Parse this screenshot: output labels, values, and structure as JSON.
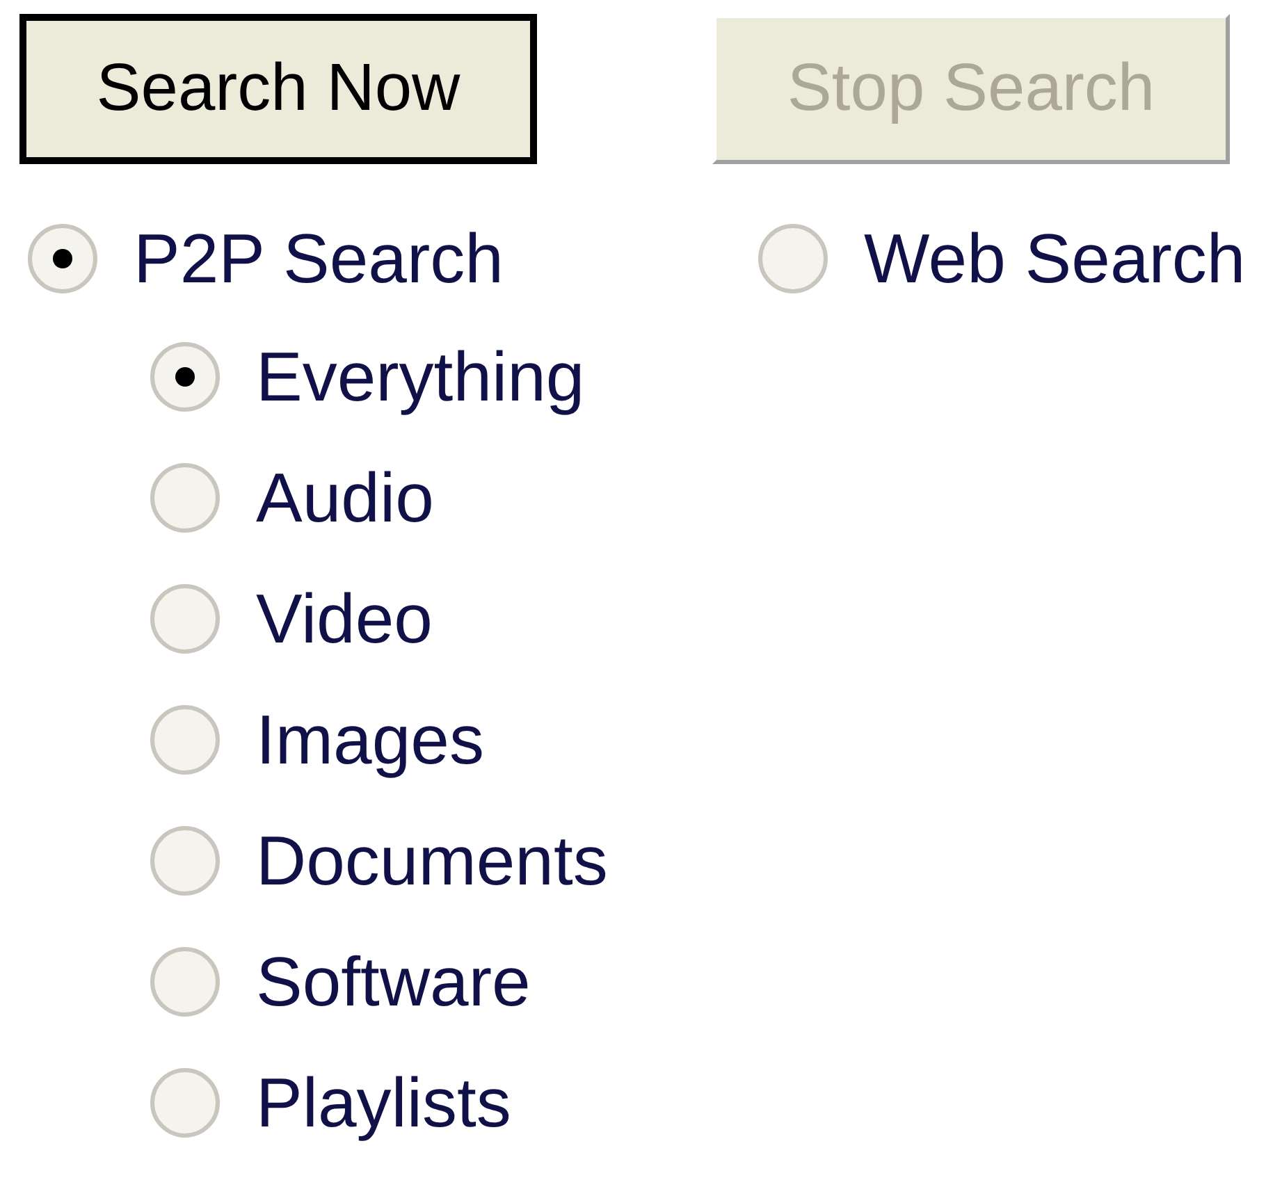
{
  "buttons": [
    {
      "label": "Search Now",
      "disabled": false,
      "default": true
    },
    {
      "label": "Stop Search",
      "disabled": true,
      "default": false
    }
  ],
  "modes": [
    {
      "label": "P2P Search",
      "selected": true
    },
    {
      "label": "Web Search",
      "selected": false
    }
  ],
  "categories": [
    {
      "label": "Everything",
      "selected": true
    },
    {
      "label": "Audio",
      "selected": false
    },
    {
      "label": "Video",
      "selected": false
    },
    {
      "label": "Images",
      "selected": false
    },
    {
      "label": "Documents",
      "selected": false
    },
    {
      "label": "Software",
      "selected": false
    },
    {
      "label": "Playlists",
      "selected": false
    }
  ]
}
